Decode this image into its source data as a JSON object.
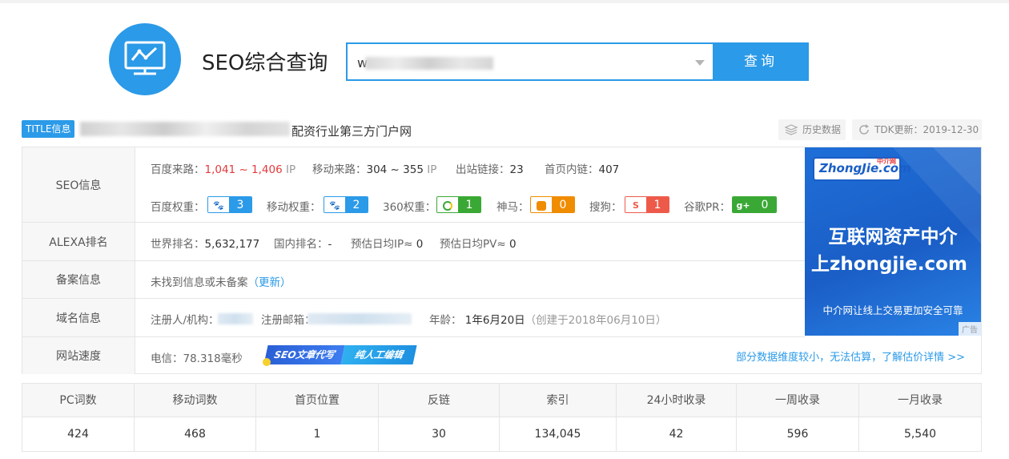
{
  "header": {
    "app_title": "SEO综合查询",
    "search_value": "w",
    "search_button": "查询"
  },
  "title_row": {
    "badge": "TITLE信息",
    "title_text": "配资行业第三方门户网",
    "history_button": "历史数据",
    "tdk_update": "TDK更新：2019-12-30"
  },
  "seo": {
    "label": "SEO信息",
    "baidu_traffic_label": "百度来路：",
    "baidu_traffic_value": "1,041 ~ 1,406",
    "baidu_traffic_unit": "IP",
    "mobile_traffic_label": "移动来路：",
    "mobile_traffic_value": "304 ~ 355",
    "mobile_traffic_unit": "IP",
    "outbound_label": "出站链接：",
    "outbound_value": "23",
    "inbound_label": "首页内链：",
    "inbound_value": "407",
    "weights": [
      {
        "label": "百度权重：",
        "value": "3"
      },
      {
        "label": "移动权重：",
        "value": "2"
      },
      {
        "label": "360权重：",
        "value": "1"
      },
      {
        "label": "神马：",
        "value": "0"
      },
      {
        "label": "搜狗：",
        "value": "1"
      },
      {
        "label": "谷歌PR：",
        "value": "0"
      }
    ]
  },
  "alexa": {
    "label": "ALEXA排名",
    "world_label": "世界排名：",
    "world_value": "5,632,177",
    "domestic_label": "国内排名：",
    "domestic_value": "-",
    "ip_label": "预估日均IP≈",
    "ip_value": "0",
    "pv_label": "预估日均PV≈",
    "pv_value": "0"
  },
  "icp": {
    "label": "备案信息",
    "text": "未找到信息或未备案",
    "update_link": "（更新）"
  },
  "domain": {
    "label": "域名信息",
    "registrant_label": "注册人/机构：",
    "email_label": "注册邮箱：",
    "age_label": "年龄：",
    "age_value": "1年6月20日",
    "created": "（创建于2018年06月10日）"
  },
  "speed": {
    "label": "网站速度",
    "telecom": "电信：78.318毫秒",
    "promo_a": "SEO文章代写",
    "promo_b": "纯人工编辑",
    "detail_link": "部分数据维度较小，无法估算，了解估价详情 >>"
  },
  "ad": {
    "logo_text": "ZhongJie.com",
    "logo_small": "中介网",
    "headline_1": "互联网资产中介",
    "headline_2": "上zhongjie.com",
    "subline": "中介网让线上交易更加安全可靠",
    "tag": "广告"
  },
  "stats": {
    "headers": [
      "PC词数",
      "移动词数",
      "首页位置",
      "反链",
      "索引",
      "24小时收录",
      "一周收录",
      "一月收录"
    ],
    "values": [
      "424",
      "468",
      "1",
      "30",
      "134,045",
      "42",
      "596",
      "5,540"
    ]
  },
  "colors": {
    "accent": "#2b9ae8",
    "red": "#e4393c",
    "green": "#3aa835",
    "orange": "#f08c00",
    "sogou_red": "#ee5a4a"
  }
}
